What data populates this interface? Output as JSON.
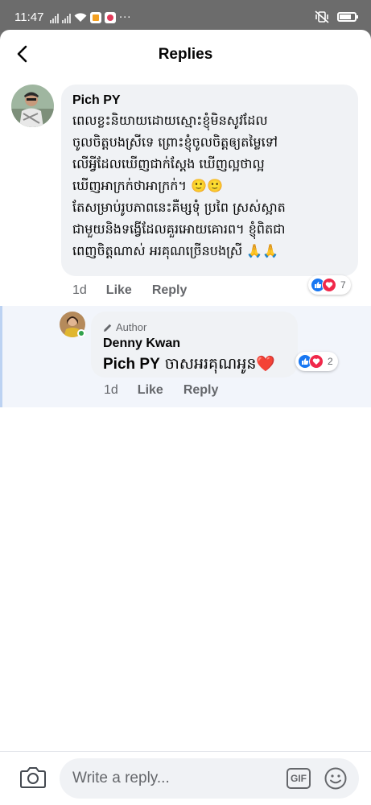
{
  "status_bar": {
    "time": "11:47",
    "icons": [
      "signal-icon",
      "signal-icon",
      "wifi-icon",
      "app-notification-icon",
      "app-notification-icon",
      "more-dots-icon",
      "vibrate-icon",
      "battery-icon"
    ]
  },
  "header": {
    "title": "Replies",
    "back_icon": "back-arrow-icon"
  },
  "comment": {
    "author": "Pich PY",
    "lines": [
      "ពេលខ្លះនិយាយដោយស្មោះខ្ញុំមិនសូវដែល",
      "ចូលចិត្តបងស្រីទេ ព្រោះខ្ញុំចូលចិត្តឲ្យតម្លៃទៅ",
      "លើអ្វីដែលឃើញជាក់ស្តែង ឃើញល្អថាល្អ",
      "ឃើញអាក្រក់ថាអាក្រក់។ 🙂🙂",
      "តែសម្រាប់រូបភាពនេះគឺម្សទុំ ប្រពៃ ស្រស់ស្អាត",
      "ជាមួយនិងទង្វើដែលគួរអោយគោរព។  ខ្ញុំពិតជា",
      "ពេញចិត្តណាស់ អរគុណច្រើនបងស្រី 🙏🙏"
    ],
    "time": "1d",
    "like_label": "Like",
    "reply_label": "Reply",
    "reaction_count": "7"
  },
  "reply": {
    "badge": "Author",
    "author": "Denny Kwan",
    "mention": "Pich PY",
    "text": " ចាសអរគុណអូន❤️",
    "time": "1d",
    "like_label": "Like",
    "reply_label": "Reply",
    "reaction_count": "2"
  },
  "composer": {
    "placeholder": "Write a reply...",
    "gif_label": "GIF"
  },
  "colors": {
    "accent": "#1877f2",
    "love": "#f0284a",
    "bubble": "#f0f2f5",
    "reply_band": "#f2f5fb",
    "secondary_text": "#65676b"
  }
}
